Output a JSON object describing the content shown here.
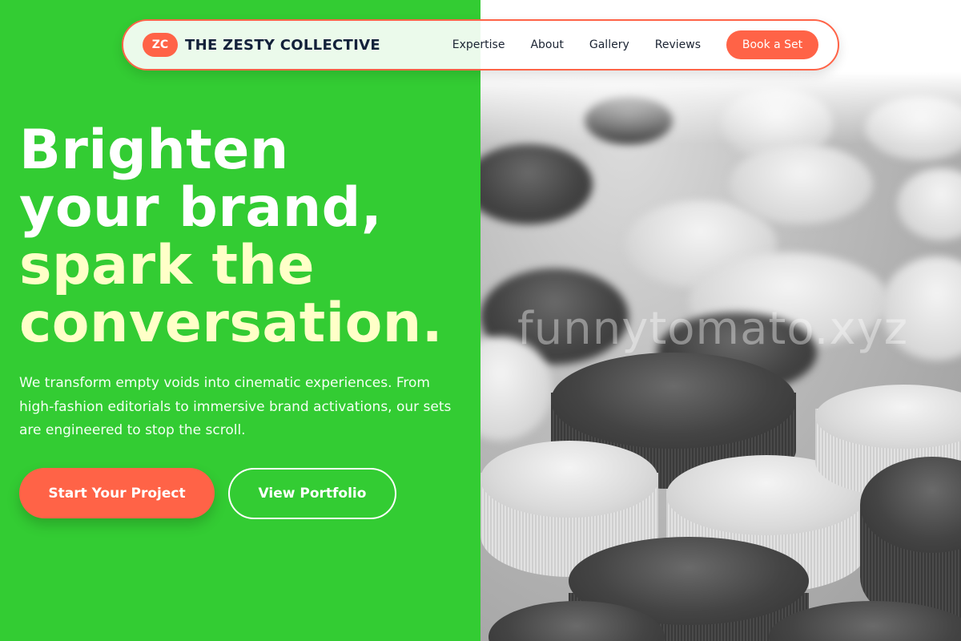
{
  "nav": {
    "logo_initials": "ZC",
    "brand_name": "THE ZESTY COLLECTIVE",
    "links": [
      "Expertise",
      "About",
      "Gallery",
      "Reviews"
    ],
    "cta_label": "Book a Set"
  },
  "hero": {
    "title_line_1": "Brighten",
    "title_line_2": "your brand,",
    "title_line_3": "spark the",
    "title_line_4": "conversation.",
    "description": "We transform empty voids into cinematic experiences. From high-fashion editorials to immersive brand activations, our sets are engineered to stop the scroll.",
    "primary_button": "Start Your Project",
    "secondary_button": "View Portfolio"
  },
  "image": {
    "watermark": "funnytomato.xyz"
  },
  "colors": {
    "green_panel": "#33cc33",
    "accent": "#ff6347",
    "highlight_text": "#ffffc8",
    "brand_text": "#13213a"
  }
}
